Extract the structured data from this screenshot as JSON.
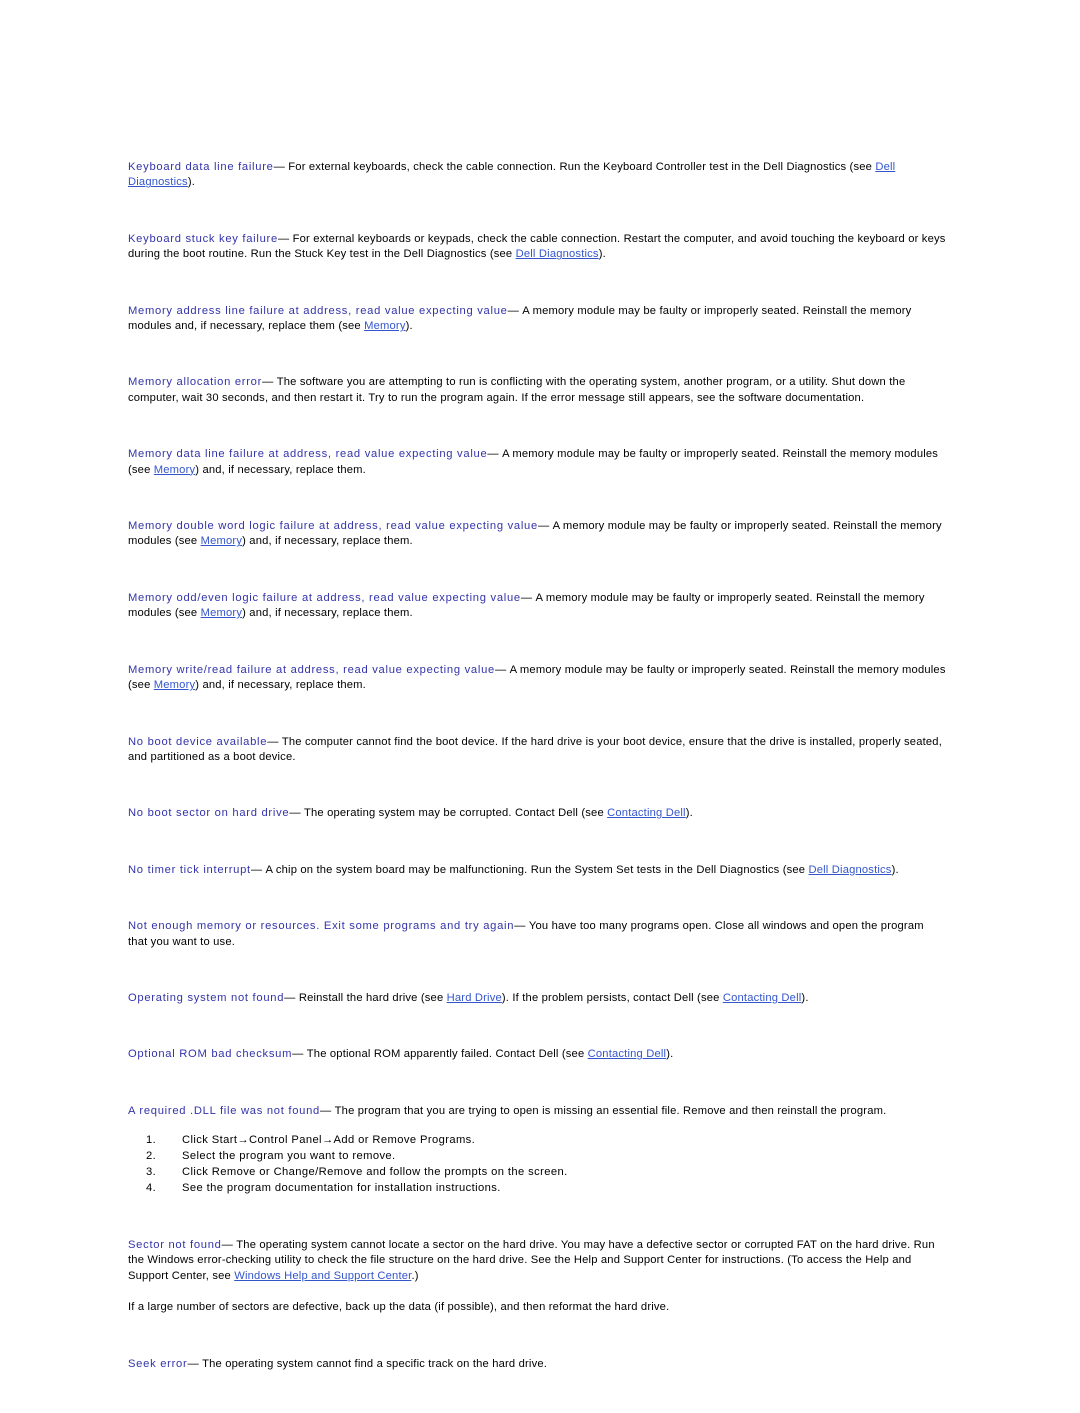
{
  "document": {
    "type": "help-reference-page",
    "background_color": "#ffffff",
    "heading_color": "#3333aa",
    "link_color": "#3355cc",
    "body_color": "#000000",
    "dash": "—"
  },
  "entries": [
    {
      "term": "Keyboard data line failure",
      "body_1": "For external keyboards, check the cable connection. Run the Keyboard Controller test in the Dell Diagnostics (see ",
      "link_1": "Dell Diagnostics",
      "body_2": ")."
    },
    {
      "term": "Keyboard stuck key failure",
      "body_1": "For external keyboards or keypads, check the cable connection. Restart the computer, and avoid touching the keyboard or keys during the boot routine. Run the Stuck Key test in the Dell Diagnostics (see ",
      "link_1": "Dell Diagnostics",
      "body_2": ")."
    },
    {
      "term": "Memory address line failure at address, read value expecting value",
      "body_1": "A memory module may be faulty or improperly seated. Reinstall the memory modules and, if necessary, replace them (see ",
      "link_1": "Memory",
      "body_2": ")."
    },
    {
      "term": "Memory allocation error",
      "body_1": "The software you are attempting to run is conflicting with the operating system, another program, or a utility. Shut down the computer, wait 30 seconds, and then restart it. Try to run the program again. If the error message still appears, see the software documentation.",
      "link_1": "",
      "body_2": ""
    },
    {
      "term": "Memory data line failure at address, read value expecting value",
      "body_1": "A memory module may be faulty or improperly seated. Reinstall the memory modules (see ",
      "link_1": "Memory",
      "body_2": ") and, if necessary, replace them."
    },
    {
      "term": "Memory double word logic failure at address, read value expecting value",
      "body_1": "A memory module may be faulty or improperly seated. Reinstall the memory modules (see ",
      "link_1": "Memory",
      "body_2": ") and, if necessary, replace them."
    },
    {
      "term": "Memory odd/even logic failure at address, read value expecting value",
      "body_1": "A memory module may be faulty or improperly seated. Reinstall the memory modules (see ",
      "link_1": "Memory",
      "body_2": ") and, if necessary, replace them."
    },
    {
      "term": "Memory write/read failure at address, read value expecting value",
      "body_1": "A memory module may be faulty or improperly seated. Reinstall the memory modules (see ",
      "link_1": "Memory",
      "body_2": ") and, if necessary, replace them."
    },
    {
      "term": "No boot device available",
      "body_1": "The computer cannot find the boot device. If the hard drive is your boot device, ensure that the drive is installed, properly seated, and partitioned as a boot device.",
      "link_1": "",
      "body_2": ""
    },
    {
      "term": "No boot sector on hard drive",
      "body_1": "The operating system may be corrupted. Contact Dell (see ",
      "link_1": "Contacting Dell",
      "body_2": ")."
    },
    {
      "term": "No timer tick interrupt",
      "body_1": "A chip on the system board may be malfunctioning. Run the System Set tests in the Dell Diagnostics (see ",
      "link_1": "Dell Diagnostics",
      "body_2": ")."
    },
    {
      "term": "Not enough memory or resources. Exit some programs and try again",
      "body_1": "You have too many programs open. Close all windows and open the program that you want to use.",
      "link_1": "",
      "body_2": ""
    },
    {
      "term": "Operating system not found",
      "body_1": "Reinstall the hard drive (see ",
      "link_1": "Hard Drive",
      "body_2": "). If the problem persists, contact Dell (see ",
      "link_2": "Contacting Dell",
      "body_3": ")."
    },
    {
      "term": "Optional ROM bad checksum",
      "body_1": "The optional ROM apparently failed. Contact Dell (see ",
      "link_1": "Contacting Dell",
      "body_2": ")."
    }
  ],
  "dll_entry": {
    "term": "A required .DLL file was not found",
    "body_1": "The program that you are trying to open is missing an essential file. Remove and then reinstall the program.",
    "steps": [
      "Click Start→Control Panel→Add or Remove Programs.",
      "Select the program you want to remove.",
      "Click Remove or Change/Remove and follow the prompts on the screen.",
      "See the program documentation for installation instructions."
    ]
  },
  "sector_entry": {
    "term": "Sector not found",
    "body_1": "The operating system cannot locate a sector on the hard drive. You may have a defective sector or corrupted FAT on the hard drive. Run the Windows error-checking utility to check the file structure on the hard drive. See the Help and Support Center for instructions. (To access the Help and Support Center, see ",
    "link_1": "Windows Help and Support Center",
    "body_2": ".)",
    "subpara": "If a large number of sectors are defective, back up the data (if possible), and then reformat the hard drive."
  },
  "seek_entry": {
    "term": "Seek error",
    "body_1": "The operating system cannot find a specific track on the hard drive.",
    "link_1": "",
    "body_2": ""
  }
}
